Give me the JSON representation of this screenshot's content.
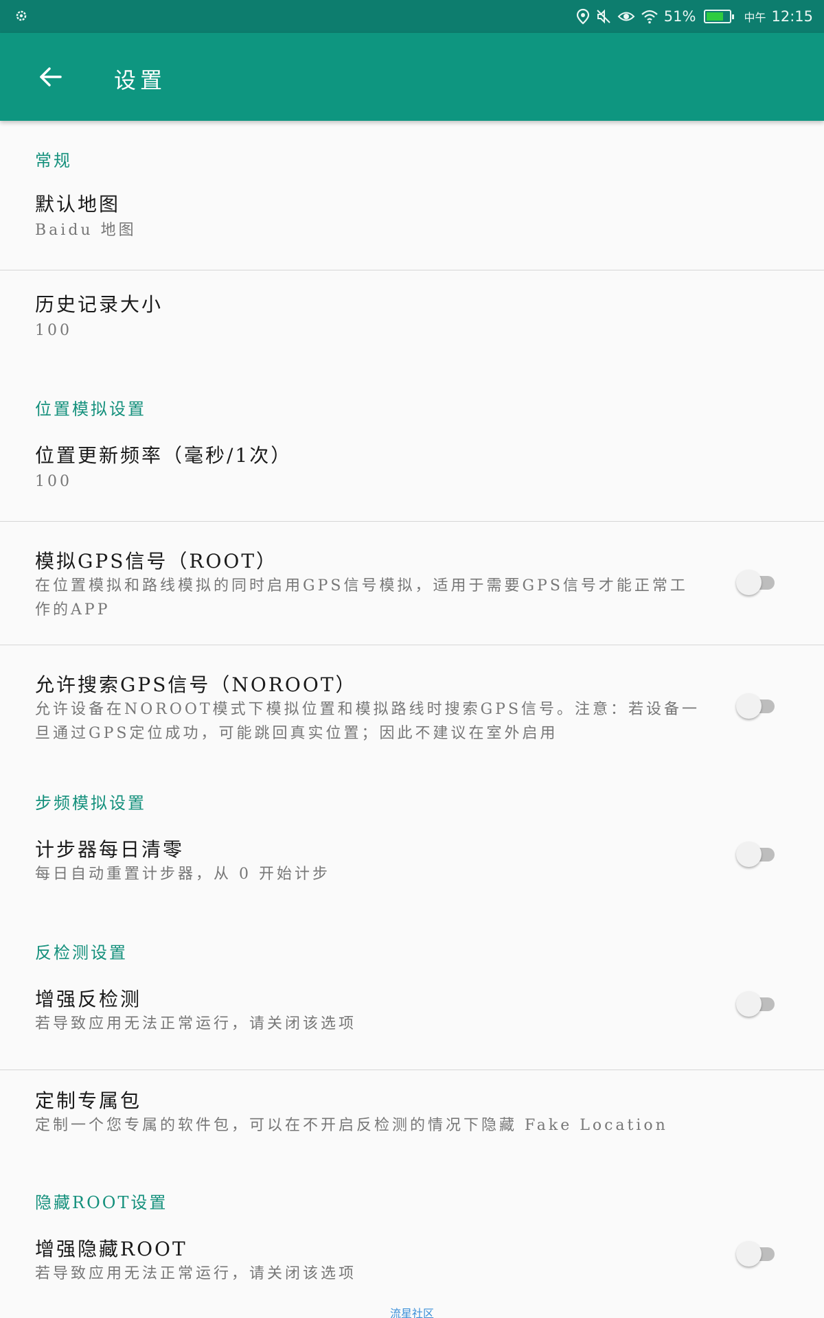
{
  "status_bar": {
    "time": "12:15",
    "period": "中午",
    "battery_percent": "51%",
    "icons": [
      "settings-gear-icon",
      "location-icon",
      "mute-icon",
      "eye-icon",
      "wifi-icon",
      "battery-icon"
    ]
  },
  "appbar": {
    "title": "设置"
  },
  "sections": {
    "general": {
      "header": "常规",
      "default_map": {
        "title": "默认地图",
        "summary": "Baidu 地图"
      },
      "history_size": {
        "title": "历史记录大小",
        "summary": "100"
      }
    },
    "location_sim": {
      "header": "位置模拟设置",
      "update_freq": {
        "title": "位置更新频率（毫秒/1次）",
        "summary": "100"
      },
      "simulate_gps": {
        "title": "模拟GPS信号（ROOT）",
        "summary": "在位置模拟和路线模拟的同时启用GPS信号模拟，适用于需要GPS信号才能正常工作的APP",
        "enabled": false
      },
      "allow_search_gps": {
        "title": "允许搜索GPS信号（NOROOT）",
        "summary": "允许设备在NOROOT模式下模拟位置和模拟路线时搜索GPS信号。注意：若设备一旦通过GPS定位成功，可能跳回真实位置；因此不建议在室外启用",
        "enabled": false
      }
    },
    "step_sim": {
      "header": "步频模拟设置",
      "pedometer_reset": {
        "title": "计步器每日清零",
        "summary": "每日自动重置计步器，从 0 开始计步",
        "enabled": false
      }
    },
    "anti_detect": {
      "header": "反检测设置",
      "enhance_anti_detect": {
        "title": "增强反检测",
        "summary": "若导致应用无法正常运行，请关闭该选项",
        "enabled": false
      },
      "custom_package": {
        "title": "定制专属包",
        "summary": "定制一个您专属的软件包，可以在不开启反检测的情况下隐藏 Fake Location"
      }
    },
    "hide_root": {
      "header": "隐藏ROOT设置",
      "enhance_hide_root": {
        "title": "增强隐藏ROOT",
        "summary": "若导致应用无法正常运行，请关闭该选项",
        "enabled": false
      }
    }
  },
  "watermark": "流星社区",
  "colors": {
    "status_bar": "#0d7d6e",
    "appbar": "#0e9680",
    "accent": "#14907c",
    "background": "#fafafa"
  }
}
